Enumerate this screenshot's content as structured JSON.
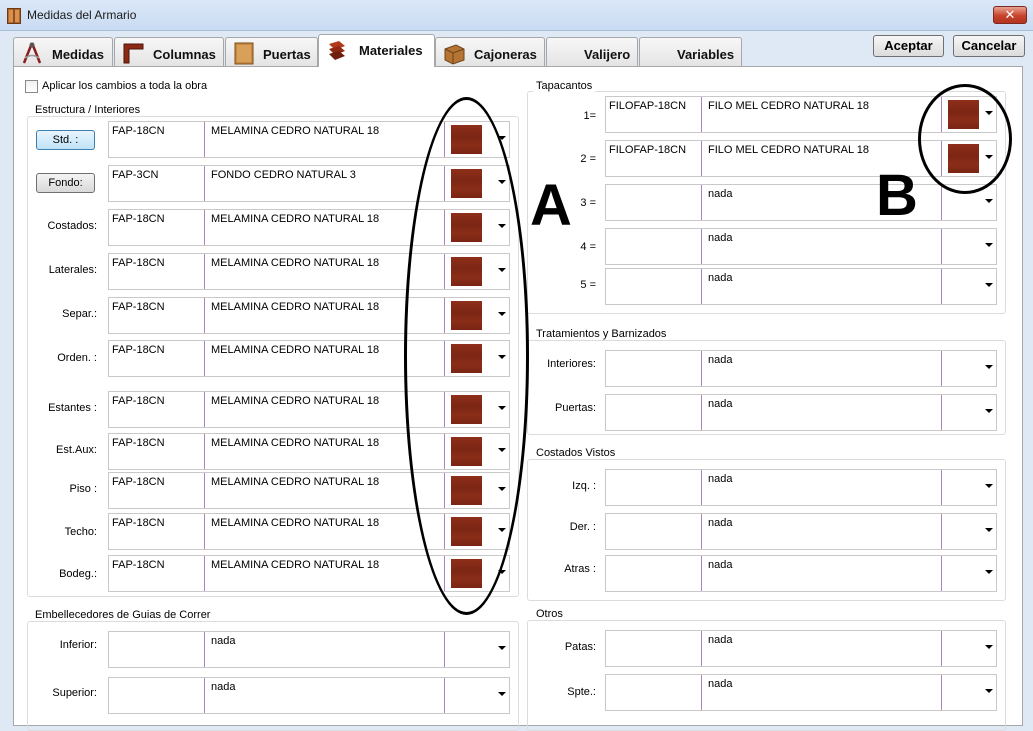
{
  "window": {
    "title": "Medidas del Armario",
    "close_label": "✕"
  },
  "tabs": [
    {
      "label": "Medidas",
      "icon": "compass-icon"
    },
    {
      "label": "Columnas",
      "icon": "columns-icon"
    },
    {
      "label": "Puertas",
      "icon": "door-icon"
    },
    {
      "label": "Materiales",
      "icon": "materials-icon"
    },
    {
      "label": "Cajoneras",
      "icon": "drawer-icon"
    },
    {
      "label": "Valijero",
      "icon": ""
    },
    {
      "label": "Variables",
      "icon": ""
    }
  ],
  "toolbar": {
    "accept_label": "Aceptar",
    "cancel_label": "Cancelar"
  },
  "apply_all_label": "Aplicar los cambios a toda la obra",
  "annotations": {
    "a": "A",
    "b": "B"
  },
  "colors": {
    "swatch": "#7f2816",
    "separator": "#a983c6"
  },
  "estructura": {
    "title": "Estructura / Interiores",
    "rows": [
      {
        "label": "Std. :",
        "code": "FAP-18CN",
        "desc": "MELAMINA CEDRO NATURAL 18"
      },
      {
        "label": "Fondo:",
        "code": "FAP-3CN",
        "desc": "FONDO CEDRO NATURAL 3"
      },
      {
        "label": "Costados:",
        "code": "FAP-18CN",
        "desc": "MELAMINA CEDRO NATURAL 18"
      },
      {
        "label": "Laterales:",
        "code": "FAP-18CN",
        "desc": "MELAMINA CEDRO NATURAL 18"
      },
      {
        "label": "Separ.:",
        "code": "FAP-18CN",
        "desc": "MELAMINA CEDRO NATURAL 18"
      },
      {
        "label": "Orden. :",
        "code": "FAP-18CN",
        "desc": "MELAMINA CEDRO NATURAL 18"
      },
      {
        "label": "Estantes :",
        "code": "FAP-18CN",
        "desc": "MELAMINA CEDRO NATURAL 18"
      },
      {
        "label": "Est.Aux:",
        "code": "FAP-18CN",
        "desc": "MELAMINA CEDRO NATURAL 18"
      },
      {
        "label": "Piso :",
        "code": "FAP-18CN",
        "desc": "MELAMINA CEDRO NATURAL 18"
      },
      {
        "label": "Techo:",
        "code": "FAP-18CN",
        "desc": "MELAMINA CEDRO NATURAL 18"
      },
      {
        "label": "Bodeg.:",
        "code": "FAP-18CN",
        "desc": "MELAMINA CEDRO NATURAL 18"
      }
    ]
  },
  "embellecedores": {
    "title": "Embellecedores de Guias de Correr",
    "rows": [
      {
        "label": "Inferior:",
        "code": "",
        "desc": "nada"
      },
      {
        "label": "Superior:",
        "code": "",
        "desc": "nada"
      }
    ]
  },
  "tapacantos": {
    "title": "Tapacantos",
    "rows": [
      {
        "label": "1=",
        "code": "FILOFAP-18CN",
        "desc": "FILO MEL CEDRO NATURAL 18"
      },
      {
        "label": "2 =",
        "code": "FILOFAP-18CN",
        "desc": "FILO MEL CEDRO NATURAL 18"
      },
      {
        "label": "3 =",
        "code": "",
        "desc": "nada"
      },
      {
        "label": "4 =",
        "code": "",
        "desc": "nada"
      },
      {
        "label": "5 =",
        "code": "",
        "desc": "nada"
      }
    ]
  },
  "tratamientos": {
    "title": "Tratamientos y Barnizados",
    "rows": [
      {
        "label": "Interiores:",
        "code": "",
        "desc": "nada"
      },
      {
        "label": "Puertas:",
        "code": "",
        "desc": "nada"
      }
    ]
  },
  "costados_vistos": {
    "title": "Costados Vistos",
    "rows": [
      {
        "label": "Izq. :",
        "code": "",
        "desc": "nada"
      },
      {
        "label": "Der. :",
        "code": "",
        "desc": "nada"
      },
      {
        "label": "Atras :",
        "code": "",
        "desc": "nada"
      }
    ]
  },
  "otros": {
    "title": "Otros",
    "rows": [
      {
        "label": "Patas:",
        "code": "",
        "desc": "nada"
      },
      {
        "label": "Spte.:",
        "code": "",
        "desc": "nada"
      }
    ]
  }
}
